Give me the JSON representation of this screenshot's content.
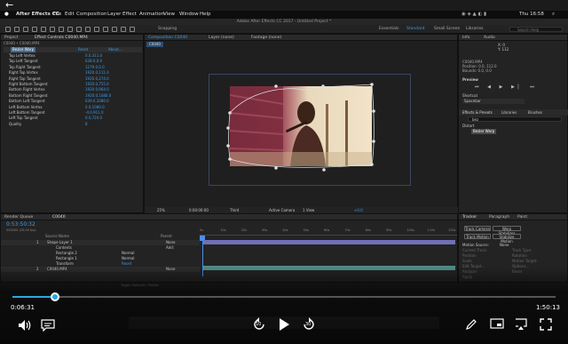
{
  "player": {
    "current_time": "0:06:31",
    "total_time": "1:50:13",
    "progress": 0.078,
    "skip_back": "10",
    "skip_forward": "30"
  },
  "mac": {
    "app_menu": "After Effects CC",
    "menus": [
      "File",
      "Edit",
      "Composition",
      "Layer",
      "Effect",
      "Animation",
      "View",
      "Window",
      "Help"
    ],
    "clock": "Thu 16:58",
    "window_title": "Adobe After Effects CC 2017 - Untitled Project *"
  },
  "ae": {
    "workspaces": [
      "Essentials",
      "Standard",
      "Small Screen",
      "Libraries"
    ],
    "search_placeholder": "Search Help",
    "project_tab": "Project",
    "effect_controls_tab": "Effect Controls C0040.MP4",
    "ec_breadcrumb": "C0040 • C0040.MP4",
    "ec_columns": [
      "Reset",
      "About..."
    ],
    "effect_name": "Bezier Warp",
    "comp_tabs": [
      "Composition C0040",
      "Layer (none)",
      "Footage (none)"
    ],
    "comp_subtab": "C0040",
    "snapping": "Snapping",
    "info_tab": "Info",
    "audio_tab": "Audio",
    "info_xy": [
      "X: 0",
      "Y: 112"
    ],
    "info_lines": [
      "C0040.MP4",
      "Position: 0.0, 112.0",
      "Bounds: 0.0, 0.0"
    ],
    "preview_label": "Preview",
    "shortcut_label": "Shortcut",
    "shortcut_value": "Spacebar",
    "effects_tabs": [
      "Effects & Presets",
      "Libraries",
      "Brushes"
    ],
    "effects_search": "bez",
    "distort_label": "Distort",
    "effects_result": "Bezier Warp",
    "viewer_zoom": "25%",
    "viewer_time": "0:00:00:00",
    "viewer_res": "Third",
    "viewer_camera": "Active Camera",
    "viewer_views": "1 View",
    "viewer_offset": "+0.0",
    "render_queue_tab": "Render Queue",
    "timeline_tab": "C0040",
    "timecode": "0:53:50:32",
    "timeline_subtext": "000000 (25.00 fps)",
    "source_name_header": "Source Name",
    "parent_header": "Parent",
    "tl_ticks": [
      "0s",
      "10s",
      "20s",
      "30s",
      "40s",
      "50s",
      "60s",
      "70s",
      "80s",
      "90s",
      "100s",
      "110s",
      "120s"
    ],
    "tracker_tab": "Tracker",
    "paragraph_tab": "Paragraph",
    "paint_tab": "Paint",
    "tracker_buttons": [
      "Track Camera",
      "Warp Stabilizer",
      "Track Motion",
      "Stabilize Motion"
    ],
    "motion_source_label": "Motion Source:",
    "motion_source_value": "None",
    "tracker_lines": [
      "Current Track:",
      "Track Type:",
      "Position",
      "Rotation",
      "Scale",
      "Motion Target:",
      "Edit Target...",
      "Options...",
      "Analyze:",
      "Reset",
      "Apply"
    ],
    "bottom_status": "Toggle Switches / Modes"
  },
  "effect_params": [
    {
      "name": "Top Left Vertex",
      "value": "0.0,311.0"
    },
    {
      "name": "Top Left Tangent",
      "value": "638.0,0.0"
    },
    {
      "name": "Top Right Tangent",
      "value": "1279.0,0.0"
    },
    {
      "name": "Right Top Vertex",
      "value": "1920.0,111.0"
    },
    {
      "name": "Right Top Tangent",
      "value": "1920.0,274.0"
    },
    {
      "name": "Right Bottom Tangent",
      "value": "1920.0,755.0"
    },
    {
      "name": "Bottom Right Vertex",
      "value": "1920.0,964.0"
    },
    {
      "name": "Bottom Right Tangent",
      "value": "1920.0,1080.0"
    },
    {
      "name": "Bottom Left Tangent",
      "value": "639.0,1080.0"
    },
    {
      "name": "Left Bottom Vertex",
      "value": "0.0,1080.0"
    },
    {
      "name": "Left Bottom Tangent",
      "value": "-4.0,911.0"
    },
    {
      "name": "Left Top Tangent",
      "value": "0.0,720.0"
    },
    {
      "name": "Quality",
      "value": "8"
    }
  ],
  "layers": [
    {
      "num": "1",
      "name": "Shape Layer 1",
      "mode": "",
      "parent": "None"
    },
    {
      "num": "",
      "name": "Contents",
      "mode": "",
      "parent": "Add:"
    },
    {
      "num": "",
      "name": "Rectangle 2",
      "mode": "Normal",
      "parent": ""
    },
    {
      "num": "",
      "name": "Rectangle 1",
      "mode": "Normal",
      "parent": ""
    },
    {
      "num": "",
      "name": "Transform",
      "mode": "Reset",
      "parent": ""
    },
    {
      "num": "2",
      "name": "C0040.MP4",
      "mode": "",
      "parent": "None"
    }
  ],
  "colors": {
    "accent_blue": "#3c9be8",
    "shape_layer_bar": "#7070b8",
    "footage_bar": "#4f8c86",
    "playhead": "#4a8fe8"
  },
  "icons": [
    "back-arrow-icon",
    "subtitles-icon",
    "volume-icon",
    "skip-back-icon",
    "play-icon",
    "skip-forward-icon",
    "pen-icon",
    "cast-icon",
    "fullscreen-icon"
  ]
}
